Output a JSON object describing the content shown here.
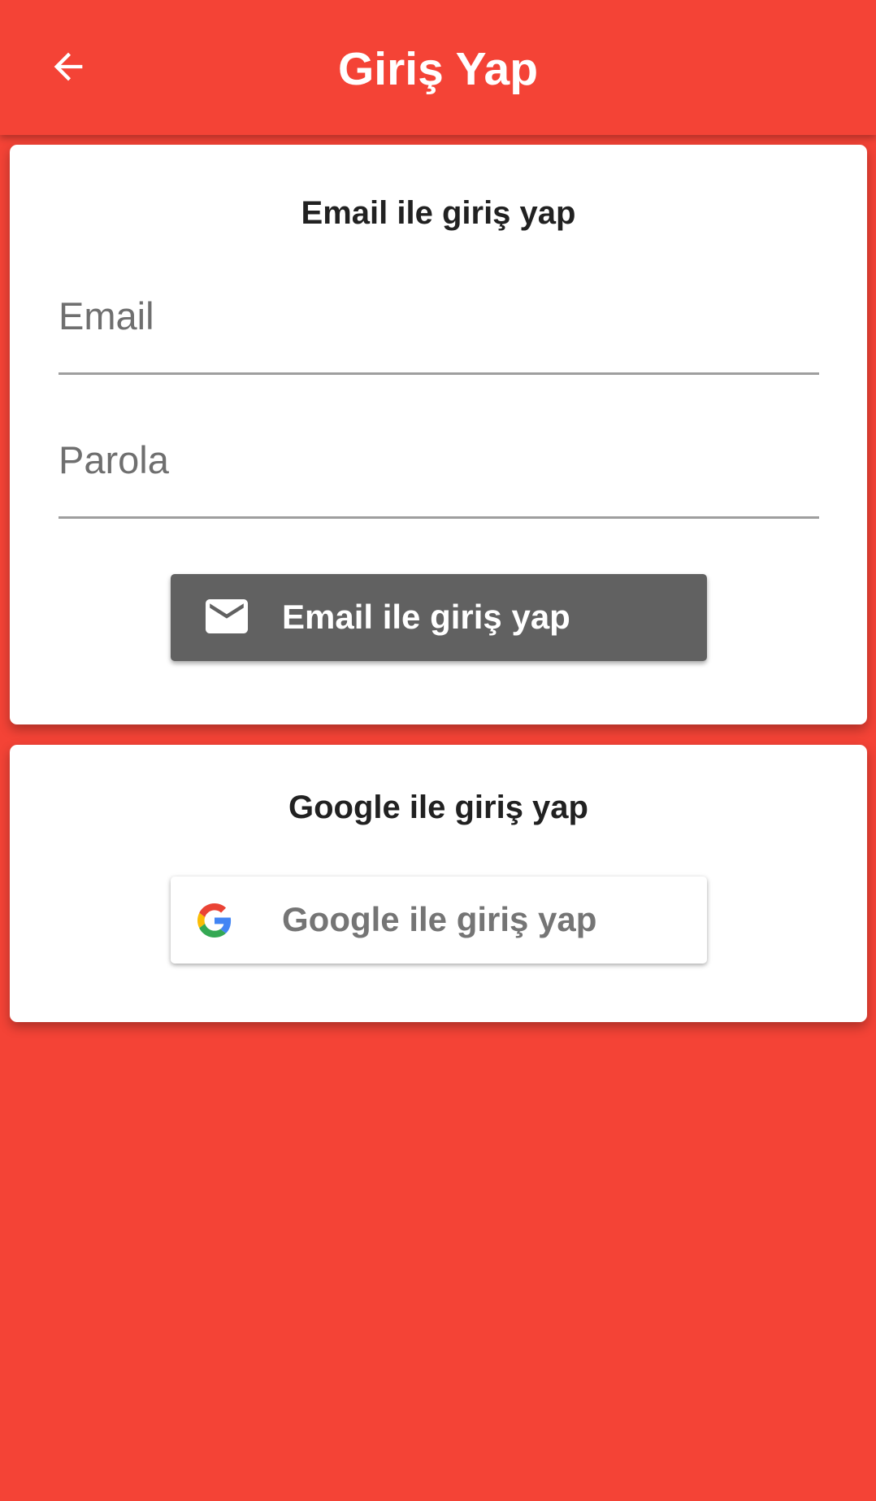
{
  "app_bar": {
    "title": "Giriş Yap",
    "back_icon": "arrow-back-icon",
    "background_color": "#F44336"
  },
  "email_card": {
    "title": "Email ile giriş yap",
    "email_field": {
      "placeholder": "Email",
      "value": ""
    },
    "password_field": {
      "placeholder": "Parola",
      "value": ""
    },
    "submit_button": {
      "label": "Email ile giriş yap",
      "icon": "mail-icon",
      "background_color": "#616161"
    }
  },
  "google_card": {
    "title": "Google ile giriş yap",
    "google_button": {
      "label": "Google ile giriş yap",
      "icon": "google-logo-icon"
    }
  }
}
